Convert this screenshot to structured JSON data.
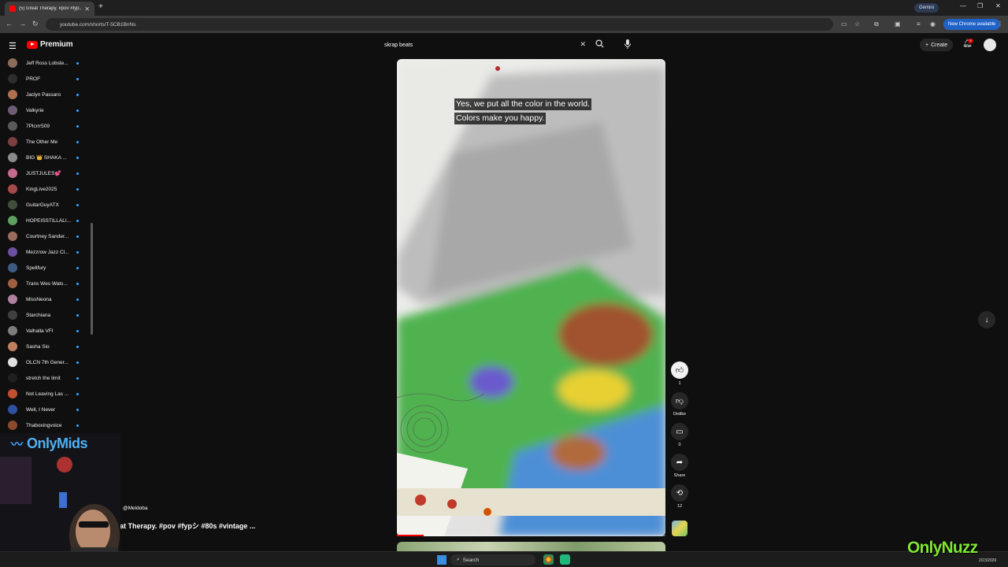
{
  "browser": {
    "tab_title": "(5) Great Therapy. #pov #fyp...",
    "new_tab": "+",
    "gemini": "Gemini",
    "url": "youtube.com/shorts/T-5CB1BnNs",
    "new_chrome": "New Chrome available"
  },
  "header": {
    "brand": "Premium",
    "search_query": "skrap beats",
    "create_label": "Create",
    "notifications_count": "9"
  },
  "sidebar": {
    "subscriptions": [
      {
        "name": "Jeff Ross Lobste...",
        "color": "#8b6b5a"
      },
      {
        "name": "PROF",
        "color": "#2e2e2e"
      },
      {
        "name": "Jaclyn Passaro",
        "color": "#b0704f"
      },
      {
        "name": "Valkyrie",
        "color": "#6f5b74"
      },
      {
        "name": "7Plcrrr509",
        "color": "#5a5a5a"
      },
      {
        "name": "The Other Me",
        "color": "#7b3f3f"
      },
      {
        "name": "BIG 👑 SHAKA ...",
        "color": "#8a8a8a"
      },
      {
        "name": "JUSTJULES💕",
        "color": "#c46a8c"
      },
      {
        "name": "KingLive2025",
        "color": "#a34a4a"
      },
      {
        "name": "GuitarGuyATX",
        "color": "#3f4f3a"
      },
      {
        "name": "HOPEISSTILLALI...",
        "color": "#5f9f5f"
      },
      {
        "name": "Courtney Sander...",
        "color": "#9b6b5b"
      },
      {
        "name": "Mezzrow Jazz Cl...",
        "color": "#6b4fa0"
      },
      {
        "name": "Spellfury",
        "color": "#3d5a80"
      },
      {
        "name": "Trans Wes Wats...",
        "color": "#a06040"
      },
      {
        "name": "MissNeona",
        "color": "#b080a0"
      },
      {
        "name": "Starchiana",
        "color": "#404040"
      },
      {
        "name": "Valhalla VFI",
        "color": "#7c7c7c"
      },
      {
        "name": "Sasha Sio",
        "color": "#c08060"
      },
      {
        "name": "OLCN 7th Gener...",
        "color": "#e0e0e0"
      },
      {
        "name": "stretch the limit",
        "color": "#202020"
      },
      {
        "name": "Not Leaving Las ...",
        "color": "#c05030"
      },
      {
        "name": "Well, I Never",
        "color": "#3050a0"
      },
      {
        "name": "Thaboxingvoice",
        "color": "#8a4a2a"
      }
    ]
  },
  "short": {
    "caption_line1": "Yes, we put all the color in the world.",
    "caption_line2": "Colors make you happy.",
    "progress": 0.1,
    "channel": "@Meldoba",
    "title": "at Therapy. #pov #fypシ #80s #vintage ..."
  },
  "actions": {
    "like_count": "1",
    "dislike_label": "Dislike",
    "comments_count": "0",
    "share_label": "Share",
    "remix_count": "12"
  },
  "overlay": {
    "cam_brand": "OnlyMids",
    "corner_brand": "OnlyNuzz",
    "date": "2/23/2026"
  },
  "taskbar": {
    "search_label": "Search"
  }
}
